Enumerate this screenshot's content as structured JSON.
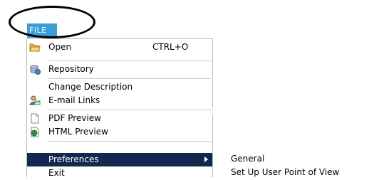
{
  "menubar": {
    "file_label": "FILE"
  },
  "menu": {
    "items": [
      {
        "label": "Open",
        "shortcut": "CTRL+O",
        "icon": "folder-open-icon"
      },
      {
        "label": "Repository",
        "icon": "repository-icon"
      },
      {
        "label": "Change Description"
      },
      {
        "label": "E-mail Links",
        "icon": "email-links-icon"
      },
      {
        "label": "PDF Preview",
        "icon": "document-icon"
      },
      {
        "label": "HTML Preview",
        "icon": "html-preview-icon"
      },
      {
        "label": "Preferences",
        "icon": "submenu-arrow-icon"
      },
      {
        "label": "Exit"
      }
    ]
  },
  "submenu": {
    "items": [
      {
        "label": "General"
      },
      {
        "label": "Set Up User Point of View"
      }
    ]
  },
  "colors": {
    "file_tab": "#3a9fd9",
    "highlight": "#14274f",
    "menu_border": "#b8b8b8"
  }
}
